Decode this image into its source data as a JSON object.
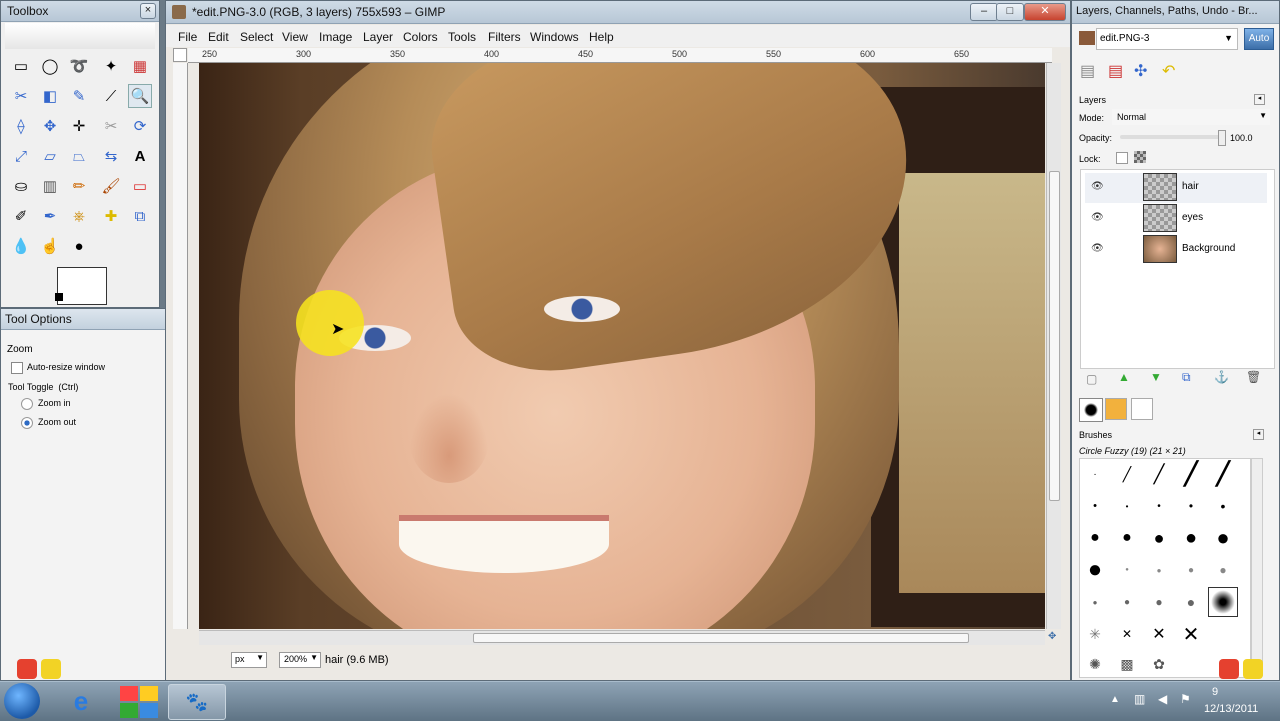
{
  "colors": {
    "accent": "#3c6ea8",
    "desktop": "#6b7a86",
    "close": "#c7432f"
  },
  "toolbox": {
    "title": "Toolbox"
  },
  "tool_options": {
    "title": "Tool Options",
    "tool": "Zoom",
    "auto_resize": "Auto-resize window",
    "toggle_label": "Tool Toggle  (Ctrl)",
    "zoom_in": "Zoom in",
    "zoom_out": "Zoom out",
    "selected": "Zoom out"
  },
  "image_window": {
    "title": "*edit.PNG-3.0 (RGB, 3 layers) 755x593 – GIMP",
    "menus": [
      "File",
      "Edit",
      "Select",
      "View",
      "Image",
      "Layer",
      "Colors",
      "Tools",
      "Filters",
      "Windows",
      "Help"
    ],
    "ruler_ticks": [
      "250",
      "300",
      "350",
      "400",
      "450",
      "500",
      "550",
      "600",
      "650"
    ],
    "unit": "px",
    "zoom": "200%",
    "status": "hair (9.6 MB)"
  },
  "dock": {
    "title": "Layers, Channels, Paths, Undo - Br...",
    "image_select": "edit.PNG-3",
    "auto_button": "Auto",
    "layers_label": "Layers",
    "mode_label": "Mode:",
    "mode_value": "Normal",
    "opacity_label": "Opacity:",
    "opacity_value": "100.0",
    "lock_label": "Lock:",
    "layers": [
      {
        "name": "hair"
      },
      {
        "name": "eyes"
      },
      {
        "name": "Background"
      }
    ],
    "brushes_label": "Brushes",
    "brush_name": "Circle Fuzzy (19) (21 × 21)"
  },
  "taskbar": {
    "time": "9",
    "date": "12/13/2011"
  }
}
